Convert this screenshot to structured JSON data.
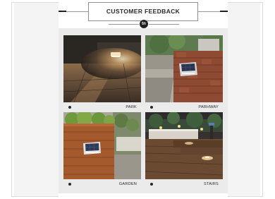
{
  "header": {
    "title": "CUSTOMER FEEDBACK",
    "logo_icon": "brand-logo-icon"
  },
  "gallery": {
    "items": [
      {
        "label": "PARK",
        "scene": "night-park-wall-light"
      },
      {
        "label": "PARHWAY",
        "scene": "brick-wall-solar-light"
      },
      {
        "label": "GARDEN",
        "scene": "wooden-planter-solar-light"
      },
      {
        "label": "STAIRS",
        "scene": "deck-stairs-lights"
      }
    ]
  },
  "colors": {
    "background": "#ebebeb",
    "title_text": "#2b2b2b",
    "border": "#8e8e8e"
  }
}
